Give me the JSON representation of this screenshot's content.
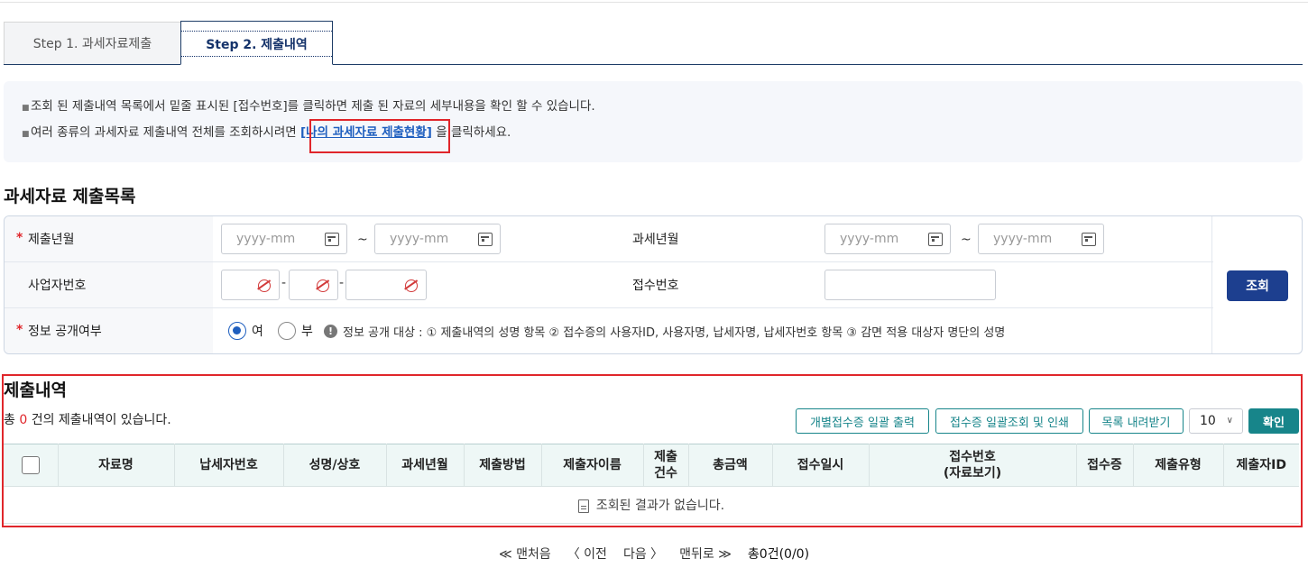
{
  "tabs": [
    {
      "label": "Step 1. 과세자료제출",
      "active": false
    },
    {
      "label": "Step 2. 제출내역",
      "active": true
    }
  ],
  "info": {
    "line1": "조회 된 제출내역 목록에서 밑줄 표시된 [접수번호]를 클릭하면 제출 된 자료의 세부내용을 확인 할 수 있습니다.",
    "line2_prefix": "여러 종류의 과세자료 제출내역 전체를 조회하시려면 ",
    "line2_link": "[나의 과세자료 제출현황]",
    "line2_suffix": " 을 클릭하세요."
  },
  "list_title": "과세자료 제출목록",
  "form": {
    "submit_ym_label": "제출년월",
    "tax_ym_label": "과세년월",
    "date_placeholder": "yyyy-mm",
    "tilde": "~",
    "biz_no_label": "사업자번호",
    "receipt_no_label": "접수번호",
    "disclosure_label": "정보 공개여부",
    "radio_yes": "여",
    "radio_no": "부",
    "radio_selected": "여",
    "notice": "정보 공개 대상 : ① 제출내역의 성명 항목 ② 접수증의 사용자ID, 사용자명, 납세자명, 납세자번호 항목 ③ 감면 적용 대상자 명단의 성명",
    "search_button": "조회"
  },
  "result": {
    "title": "제출내역",
    "count_prefix": "총 ",
    "count": "0",
    "count_suffix": " 건의 제출내역이 있습니다.",
    "buttons": {
      "batch_print": "개별접수증 일괄 출력",
      "batch_view": "접수증 일괄조회 및 인쇄",
      "download": "목록 내려받기",
      "page_size": "10",
      "confirm": "확인"
    },
    "columns": [
      "자료명",
      "납세자번호",
      "성명/상호",
      "과세년월",
      "제출방법",
      "제출자이름",
      "제출\n건수",
      "총금액",
      "접수일시",
      "접수번호\n(자료보기)",
      "접수증",
      "제출유형",
      "제출자ID"
    ],
    "empty_message": "조회된 결과가 없습니다."
  },
  "pager": {
    "first": "≪ 맨처음",
    "prev": "〈 이전",
    "next": "다음 〉",
    "last": "맨뒤로 ≫",
    "total": "총0건(0/0)"
  }
}
